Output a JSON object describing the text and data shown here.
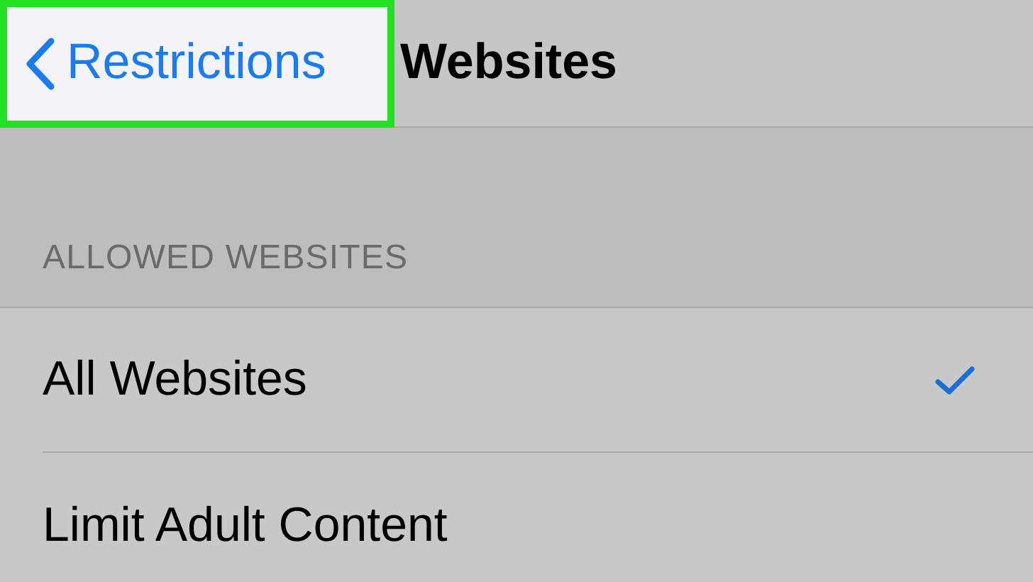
{
  "nav": {
    "back_label": "Restrictions",
    "highlighted": true,
    "title": "Websites"
  },
  "section": {
    "header": "ALLOWED WEBSITES",
    "rows": [
      {
        "label": "All Websites",
        "selected": true
      },
      {
        "label": "Limit Adult Content",
        "selected": false
      }
    ]
  }
}
